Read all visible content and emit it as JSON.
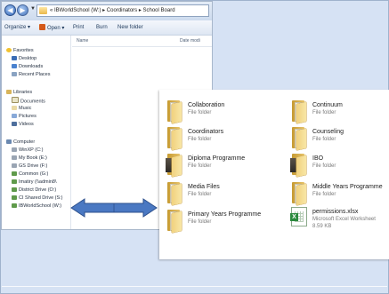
{
  "explorer": {
    "breadcrumb": "« IBWorldSchool (W:) ▸ Coordinators ▸ School Board",
    "toolbar": {
      "organize": "Organize ▾",
      "open": "Open ▾",
      "print": "Print",
      "burn": "Burn",
      "new_folder": "New folder"
    },
    "columns": {
      "name": "Name",
      "date": "Date modi"
    },
    "nav": {
      "favorites": "Favorites",
      "desktop": "Desktop",
      "downloads": "Downloads",
      "recent": "Recent Places",
      "libraries": "Libraries",
      "documents": "Documents",
      "music": "Music",
      "pictures": "Pictures",
      "videos": "Videos",
      "computer": "Computer",
      "drive_c": "WinXP (C:)",
      "drive_e": "My Book (E:)",
      "drive_f": "GS Drive (F:)",
      "drive_g": "Common (G:)",
      "drive_i": "Imatiry (\\\\admin8\\",
      "drive_o": "District Drive (O:)",
      "drive_s": "CI Shared Drive (S:)",
      "drive_w": "IBWorldSchool (W:)"
    }
  },
  "folder_view": {
    "items": [
      {
        "name": "Collaboration",
        "type": "File folder",
        "icon": "folder-icon"
      },
      {
        "name": "Continuum",
        "type": "File folder",
        "icon": "folder-icon"
      },
      {
        "name": "Coordinators",
        "type": "File folder",
        "icon": "folder-icon"
      },
      {
        "name": "Counseling",
        "type": "File folder",
        "icon": "folder-icon"
      },
      {
        "name": "Diploma Programme",
        "type": "File folder",
        "icon": "folder-photo-icon"
      },
      {
        "name": "IBO",
        "type": "File folder",
        "icon": "folder-photo-icon"
      },
      {
        "name": "Media Files",
        "type": "File folder",
        "icon": "folder-icon"
      },
      {
        "name": "Middle Years Programme",
        "type": "File folder",
        "icon": "folder-icon"
      },
      {
        "name": "Primary Years Programme",
        "type": "File folder",
        "icon": "folder-icon"
      },
      {
        "name": "permissions.xlsx",
        "type": "Microsoft Excel Worksheet",
        "size": "8.59 KB",
        "icon": "excel-file-icon"
      }
    ]
  },
  "colors": {
    "background": "#d6e2f4",
    "arrow_fill": "#4a78c2",
    "arrow_stroke": "#2c4f8c",
    "folder": "#e7c36a"
  }
}
